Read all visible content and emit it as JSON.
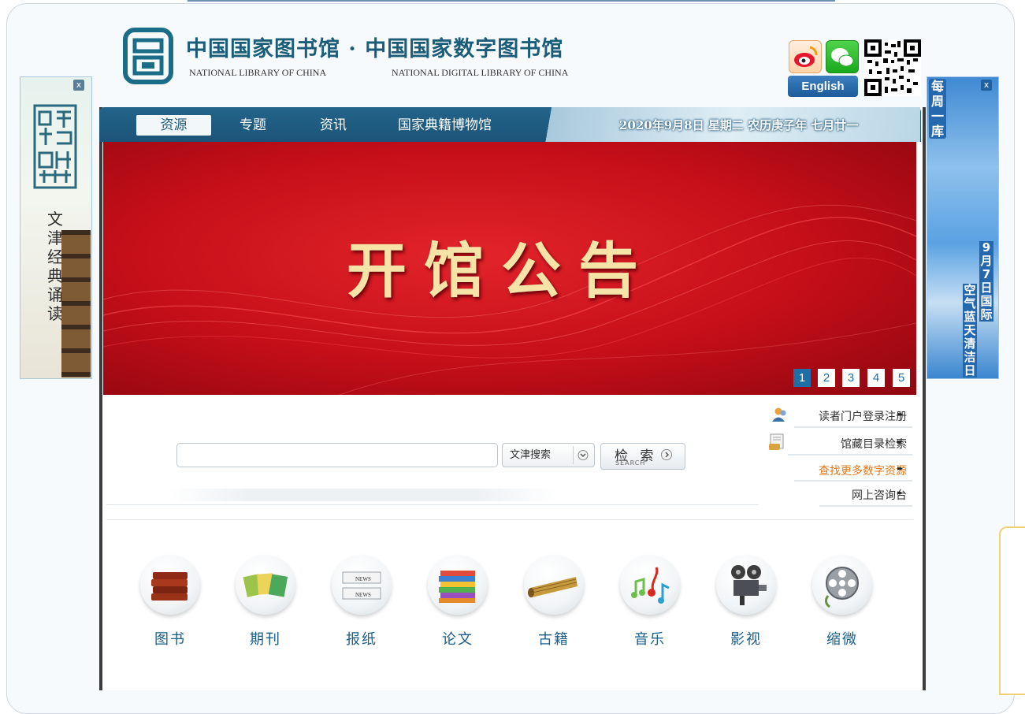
{
  "header": {
    "title": "中国国家图书馆 · 中国国家数字图书馆",
    "subtitle_left": "NATIONAL LIBRARY OF CHINA",
    "subtitle_right": "NATIONAL DIGITAL LIBRARY OF CHINA",
    "english_button": "English"
  },
  "left_ad": {
    "text": "文津经典诵读"
  },
  "right_ad": {
    "title": "每周一库",
    "col1": "9月7日国际",
    "col2": "空气蓝天清洁日"
  },
  "nav": {
    "tabs": [
      {
        "label": "资源"
      },
      {
        "label": "专题"
      },
      {
        "label": "资讯"
      },
      {
        "label": "国家典籍博物馆"
      }
    ],
    "date": "2020年9月8日  星期二   农历庚子年   七月廿一"
  },
  "hero": {
    "title": "开馆公告",
    "pages": [
      "1",
      "2",
      "3",
      "4",
      "5"
    ],
    "active_page": "1"
  },
  "search": {
    "placeholder": "",
    "scope": "文津搜索",
    "button_label": "检 索",
    "button_sub": "SEARCH"
  },
  "side_links": [
    {
      "label": "读者门户登录注册"
    },
    {
      "label": "馆藏目录检索"
    },
    {
      "label": "查找更多数字资源"
    },
    {
      "label": "网上咨询台"
    }
  ],
  "categories": [
    {
      "label": "图书",
      "icon": "books-icon"
    },
    {
      "label": "期刊",
      "icon": "journals-icon"
    },
    {
      "label": "报纸",
      "icon": "newspaper-icon"
    },
    {
      "label": "论文",
      "icon": "thesis-icon"
    },
    {
      "label": "古籍",
      "icon": "ancient-scroll-icon"
    },
    {
      "label": "音乐",
      "icon": "music-notes-icon"
    },
    {
      "label": "影视",
      "icon": "film-projector-icon"
    },
    {
      "label": "缩微",
      "icon": "film-reel-icon"
    }
  ],
  "colors": {
    "brand_teal": "#1b5d79",
    "nav_blue": "#1f5a7c",
    "hero_red": "#c40e18",
    "link_orange": "#e0781b",
    "category_blue": "#1a5e8a"
  }
}
